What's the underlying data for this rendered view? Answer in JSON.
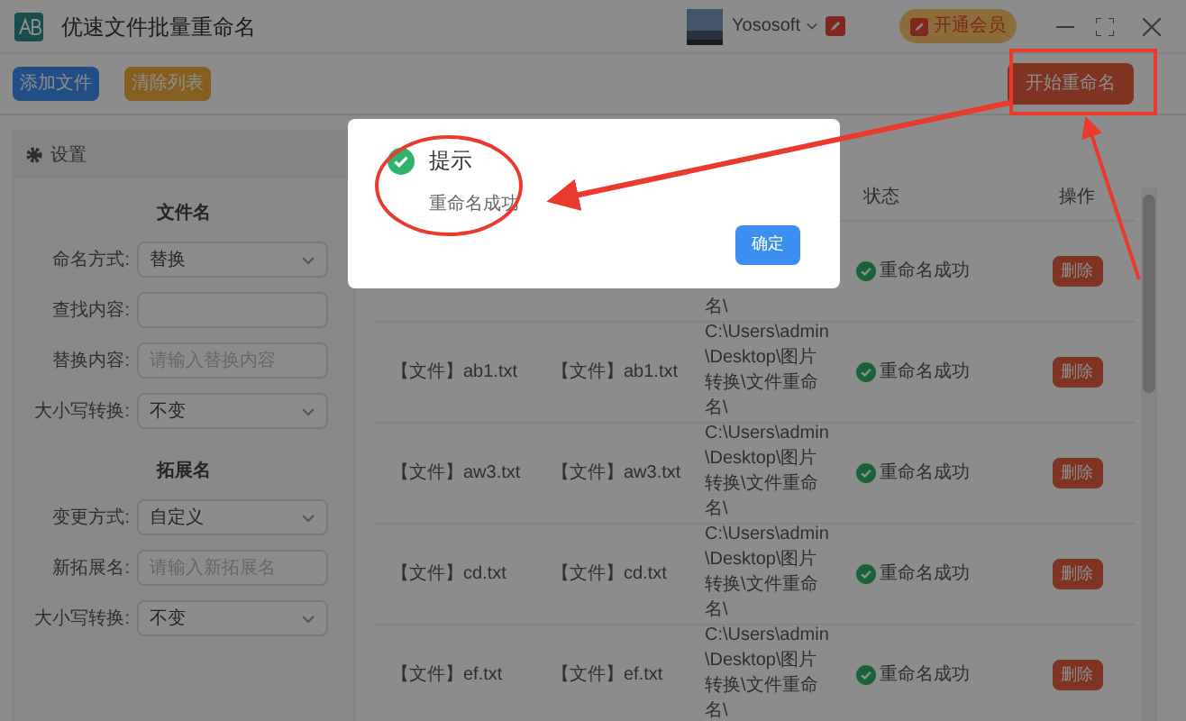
{
  "window": {
    "title": "优速文件批量重命名",
    "user": "Yososoft",
    "vip_button": "开通会员"
  },
  "toolbar": {
    "buttons": [
      {
        "label": "添加文件",
        "kind": "primary"
      },
      {
        "label": "清除列表",
        "kind": "warning"
      }
    ],
    "start_button": "开始重命名"
  },
  "settings": {
    "title": "设置",
    "sections": [
      {
        "heading": "文件名",
        "fields": [
          {
            "label": "命名方式:",
            "kind": "select",
            "value": "替换"
          },
          {
            "label": "查找内容:",
            "kind": "input"
          },
          {
            "label": "替换内容:",
            "kind": "input",
            "placeholder": "请输入替换内容"
          },
          {
            "label": "大小写转换:",
            "kind": "select",
            "value": "不变"
          }
        ]
      },
      {
        "heading": "拓展名",
        "fields": [
          {
            "label": "变更方式:",
            "kind": "select",
            "value": "自定义"
          },
          {
            "label": "新拓展名:",
            "kind": "input",
            "placeholder": "请输入新拓展名"
          },
          {
            "label": "大小写转换:",
            "kind": "select",
            "value": "不变"
          }
        ]
      }
    ]
  },
  "table": {
    "headers": {
      "status": "状态",
      "action": "操作"
    },
    "rows": [
      {
        "path": "名\\",
        "status": "重命名成功",
        "action": "删除"
      },
      {
        "original": "【文件】ab1.txt",
        "renamed": "【文件】ab1.txt",
        "path": "C:\\Users\\admin\\Desktop\\图片转换\\文件重命名\\",
        "status": "重命名成功",
        "action": "删除"
      },
      {
        "original": "【文件】aw3.txt",
        "renamed": "【文件】aw3.txt",
        "path": "C:\\Users\\admin\\Desktop\\图片转换\\文件重命名\\",
        "status": "重命名成功",
        "action": "删除"
      },
      {
        "original": "【文件】cd.txt",
        "renamed": "【文件】cd.txt",
        "path": "C:\\Users\\admin\\Desktop\\图片转换\\文件重命名\\",
        "status": "重命名成功",
        "action": "删除"
      },
      {
        "original": "【文件】ef.txt",
        "renamed": "【文件】ef.txt",
        "path": "C:\\Users\\admin\\Desktop\\图片转换\\文件重命名\\",
        "status": "重命名成功",
        "action": "删除"
      }
    ]
  },
  "dialog": {
    "title": "提示",
    "message": "重命名成功",
    "confirm": "确定"
  }
}
